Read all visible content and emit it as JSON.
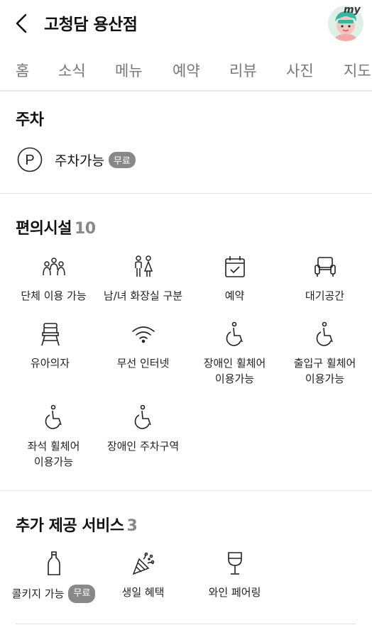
{
  "header": {
    "title": "고청담 용산점",
    "avatar_badge": "my"
  },
  "tabs": [
    "홈",
    "소식",
    "메뉴",
    "예약",
    "리뷰",
    "사진",
    "지도"
  ],
  "parking": {
    "title": "주차",
    "label": "주차가능",
    "badge": "무료"
  },
  "facilities": {
    "title": "편의시설",
    "count": "10",
    "items": [
      {
        "label": "단체 이용 가능",
        "icon": "group-icon"
      },
      {
        "label": "남/녀 화장실 구분",
        "icon": "restroom-icon"
      },
      {
        "label": "예약",
        "icon": "calendar-check-icon"
      },
      {
        "label": "대기공간",
        "icon": "armchair-icon"
      },
      {
        "label": "유아의자",
        "icon": "high-chair-icon"
      },
      {
        "label": "무선 인터넷",
        "icon": "wifi-icon"
      },
      {
        "label": "장애인 휠체어\n이용가능",
        "icon": "wheelchair-icon"
      },
      {
        "label": "출입구 휠체어\n이용가능",
        "icon": "wheelchair-icon"
      },
      {
        "label": "좌석 휠체어\n이용가능",
        "icon": "wheelchair-icon"
      },
      {
        "label": "장애인 주차구역",
        "icon": "wheelchair-icon"
      }
    ]
  },
  "services": {
    "title": "추가 제공 서비스",
    "count": "3",
    "items": [
      {
        "label": "콜키지 가능",
        "badge": "무료",
        "icon": "bottle-icon"
      },
      {
        "label": "생일 혜택",
        "icon": "party-popper-icon"
      },
      {
        "label": "와인 페어링",
        "icon": "wine-glass-icon"
      }
    ]
  }
}
